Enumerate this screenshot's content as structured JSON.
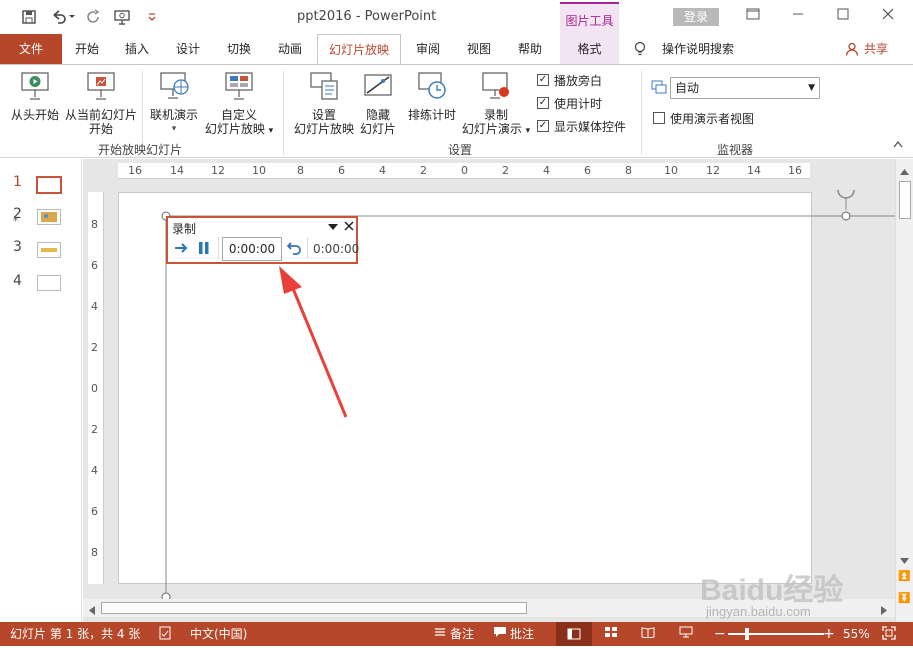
{
  "window": {
    "title": "ppt2016 - PowerPoint",
    "context_group": "图片工具",
    "login_label": "登录",
    "controls": [
      "restore-icon",
      "minimize-icon",
      "maximize-icon",
      "close-icon"
    ]
  },
  "qat": {
    "icons": [
      "save-icon",
      "undo-icon",
      "redo-icon",
      "start-from-beginning-icon",
      "customize-qat-icon"
    ]
  },
  "tabs": {
    "file": "文件",
    "items": [
      "开始",
      "插入",
      "设计",
      "切换",
      "动画",
      "幻灯片放映",
      "审阅",
      "视图",
      "帮助",
      "格式"
    ],
    "active": "幻灯片放映",
    "search": "操作说明搜索",
    "share": "共享"
  },
  "ribbon": {
    "group_start": {
      "label": "开始放映幻灯片",
      "from_beginning": "从头开始",
      "from_current_1": "从当前幻灯片",
      "from_current_2": "开始",
      "online": "联机演示",
      "custom_1": "自定义",
      "custom_2": "幻灯片放映"
    },
    "group_setup": {
      "label": "设置",
      "setup_1": "设置",
      "setup_2": "幻灯片放映",
      "hide_1": "隐藏",
      "hide_2": "幻灯片",
      "rehearse": "排练计时",
      "record_1": "录制",
      "record_2": "幻灯片演示",
      "play_narrations": "播放旁白",
      "use_timings": "使用计时",
      "show_media_controls": "显示媒体控件"
    },
    "group_monitors": {
      "label": "监视器",
      "monitor_value": "自动",
      "presenter_view": "使用演示者视图"
    }
  },
  "slides": {
    "numbers": [
      "1",
      "2",
      "3",
      "4"
    ],
    "active_index": 1
  },
  "ruler": {
    "horizontal": [
      "16",
      "14",
      "12",
      "10",
      "8",
      "6",
      "4",
      "2",
      "0",
      "2",
      "4",
      "6",
      "8",
      "10",
      "12",
      "14",
      "16"
    ],
    "vertical": [
      "8",
      "6",
      "4",
      "2",
      "0",
      "2",
      "4",
      "6",
      "8"
    ]
  },
  "recording": {
    "title": "录制",
    "elapsed": "0:00:00",
    "total": "0:00:00"
  },
  "status": {
    "slide_info": "幻灯片 第 1 张，共 4 张",
    "language": "中文(中国)",
    "notes": "备注",
    "comments": "批注",
    "zoom": "55%"
  },
  "watermark": {
    "text": "Baidu经验",
    "url": "jingyan.baidu.com"
  },
  "colors": {
    "accent": "#b7472a",
    "context": "#a3278f",
    "context_bg": "#f3e4f3",
    "arrow": "#e8403b"
  }
}
